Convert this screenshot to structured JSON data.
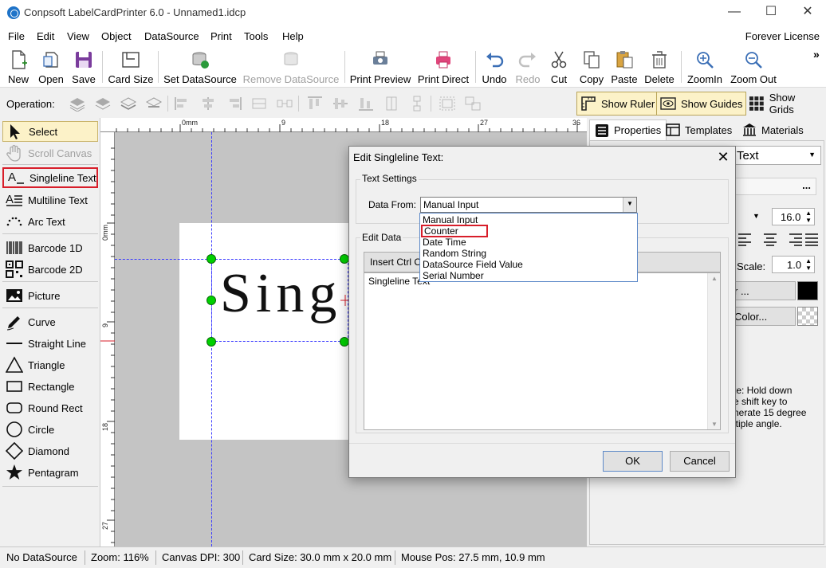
{
  "window": {
    "title": "Conpsoft LabelCardPrinter 6.0 - Unnamed1.idcp",
    "minimize": "—",
    "maximize": "☐",
    "close": "✕"
  },
  "menu": {
    "items": [
      "File",
      "Edit",
      "View",
      "Object",
      "DataSource",
      "Print",
      "Tools",
      "Help"
    ],
    "license": "Forever License"
  },
  "toolbar": {
    "new": "New",
    "open": "Open",
    "save": "Save",
    "card_size": "Card Size",
    "set_datasource": "Set DataSource",
    "remove_datasource": "Remove DataSource",
    "print_preview": "Print Preview",
    "print_direct": "Print Direct",
    "undo": "Undo",
    "redo": "Redo",
    "cut": "Cut",
    "copy": "Copy",
    "paste": "Paste",
    "delete": "Delete",
    "zoom_in": "ZoomIn",
    "zoom_out": "Zoom Out",
    "overflow": "»"
  },
  "operation": {
    "label": "Operation:",
    "show_ruler": "Show Ruler",
    "show_guides": "Show Guides",
    "show_grids": "Show Grids"
  },
  "palette": {
    "select": "Select",
    "scroll_canvas": "Scroll Canvas",
    "singleline_text": "Singleline Text",
    "multiline_text": "Multiline Text",
    "arc_text": "Arc Text",
    "barcode_1d": "Barcode 1D",
    "barcode_2d": "Barcode 2D",
    "picture": "Picture",
    "curve": "Curve",
    "straight_line": "Straight Line",
    "triangle": "Triangle",
    "rectangle": "Rectangle",
    "round_rect": "Round Rect",
    "circle": "Circle",
    "diamond": "Diamond",
    "pentagram": "Pentagram"
  },
  "ruler": {
    "top": [
      "0mm",
      "9",
      "18",
      "27",
      "36"
    ],
    "left": [
      "0mm",
      "9",
      "18",
      "27"
    ]
  },
  "canvas": {
    "text": "Sing"
  },
  "right_panel": {
    "tabs": [
      "Properties",
      "Templates",
      "Materials"
    ],
    "type_value": "Text",
    "more_button": "...",
    "font_size": "16.0",
    "scale_label": "Scale:",
    "scale_value": "1.0",
    "font_color_button": "r ...",
    "bg_color_button": "Color...",
    "note": "te: Hold down\ne shift key to\nnerate 15 degree\nltiple angle."
  },
  "dialog": {
    "title": "Edit Singleline Text:",
    "close": "✕",
    "text_settings_label": "Text Settings",
    "data_from_label": "Data From:",
    "data_from_value": "Manual Input",
    "options": [
      "Manual Input",
      "Counter",
      "Date Time",
      "Random String",
      "DataSource Field Value",
      "Serial Number"
    ],
    "edit_data_label": "Edit Data",
    "insert_button": "Insert Ctrl C",
    "textarea_value": "Singleline Text",
    "ok": "OK",
    "cancel": "Cancel"
  },
  "status": {
    "datasource": "No DataSource",
    "zoom": "Zoom: 116%",
    "dpi": "Canvas DPI: 300",
    "card_size": "Card Size: 30.0 mm x 20.0 mm",
    "mouse_pos": "Mouse Pos: 27.5 mm, 10.9 mm"
  },
  "colors": {
    "accent": "#1e73c8",
    "selection_handle": "#00d000",
    "guide": "#3a3aff",
    "highlight_border": "#d81e2a",
    "active_toggle_bg": "#fcf2c8"
  }
}
